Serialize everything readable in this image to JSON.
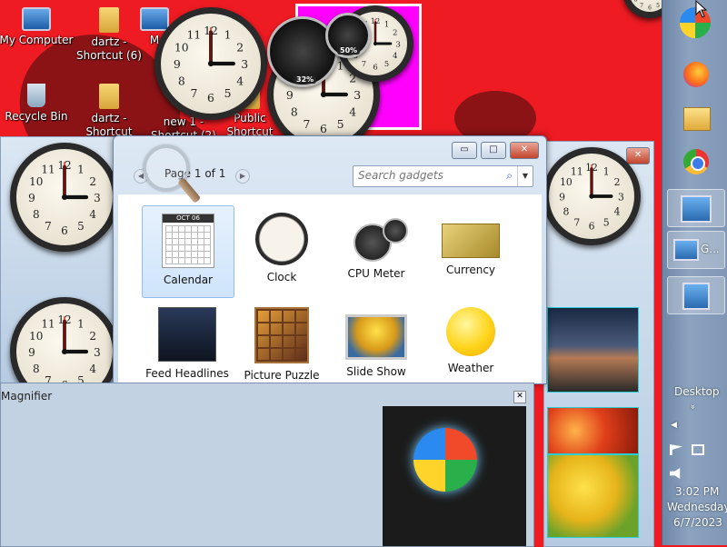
{
  "desktop": {
    "icons": [
      {
        "label": "My Computer",
        "icon": "computer-icon"
      },
      {
        "label": "dartz -\nShortcut (6)",
        "icon": "folder-shortcut-icon"
      },
      {
        "label": "M",
        "icon": "app-icon"
      },
      {
        "label": "Recycle Bin",
        "icon": "recycle-bin-icon"
      },
      {
        "label": "dartz -\nShortcut",
        "icon": "folder-shortcut-icon"
      },
      {
        "label": "new 1 -\nShortcut (2)",
        "icon": "file-shortcut-icon"
      },
      {
        "label": "Public\nShortcut",
        "icon": "folder-shortcut-icon"
      }
    ],
    "cpu_meter": {
      "cpu": "32%",
      "memory": "50%"
    }
  },
  "gadgets_window": {
    "pager": "Page 1 of 1",
    "search": {
      "placeholder": "Search gadgets"
    },
    "controls": {
      "minimize": "▭",
      "maximize": "□",
      "close": "✕"
    },
    "items": [
      {
        "label": "Calendar",
        "icon": "calendar-gadget-icon",
        "selected": true,
        "month": "OCT 06"
      },
      {
        "label": "Clock",
        "icon": "clock-gadget-icon",
        "selected": false
      },
      {
        "label": "CPU Meter",
        "icon": "cpu-meter-gadget-icon",
        "selected": false
      },
      {
        "label": "Currency",
        "icon": "currency-gadget-icon",
        "selected": false
      },
      {
        "label": "Feed Headlines",
        "icon": "feed-headlines-gadget-icon",
        "selected": false
      },
      {
        "label": "Picture Puzzle",
        "icon": "picture-puzzle-gadget-icon",
        "selected": false
      },
      {
        "label": "Slide Show",
        "icon": "slide-show-gadget-icon",
        "selected": false
      },
      {
        "label": "Weather",
        "icon": "weather-gadget-icon",
        "selected": false
      }
    ]
  },
  "magnifier": {
    "title": "Magnifier",
    "close": "✕"
  },
  "taskbar": {
    "pinned": [
      "windows-start-icon",
      "firefox-icon",
      "file-explorer-icon",
      "chrome-icon"
    ],
    "active_label": "G...",
    "desktop_label": "Desktop",
    "show_more": "»",
    "clock": {
      "time": "3:02 PM",
      "day": "Wednesday",
      "date": "6/7/2023"
    }
  },
  "colors": {
    "desktop": "#ee1b22",
    "selection": "#cfe4fb",
    "magenta": "#ff00ff"
  }
}
